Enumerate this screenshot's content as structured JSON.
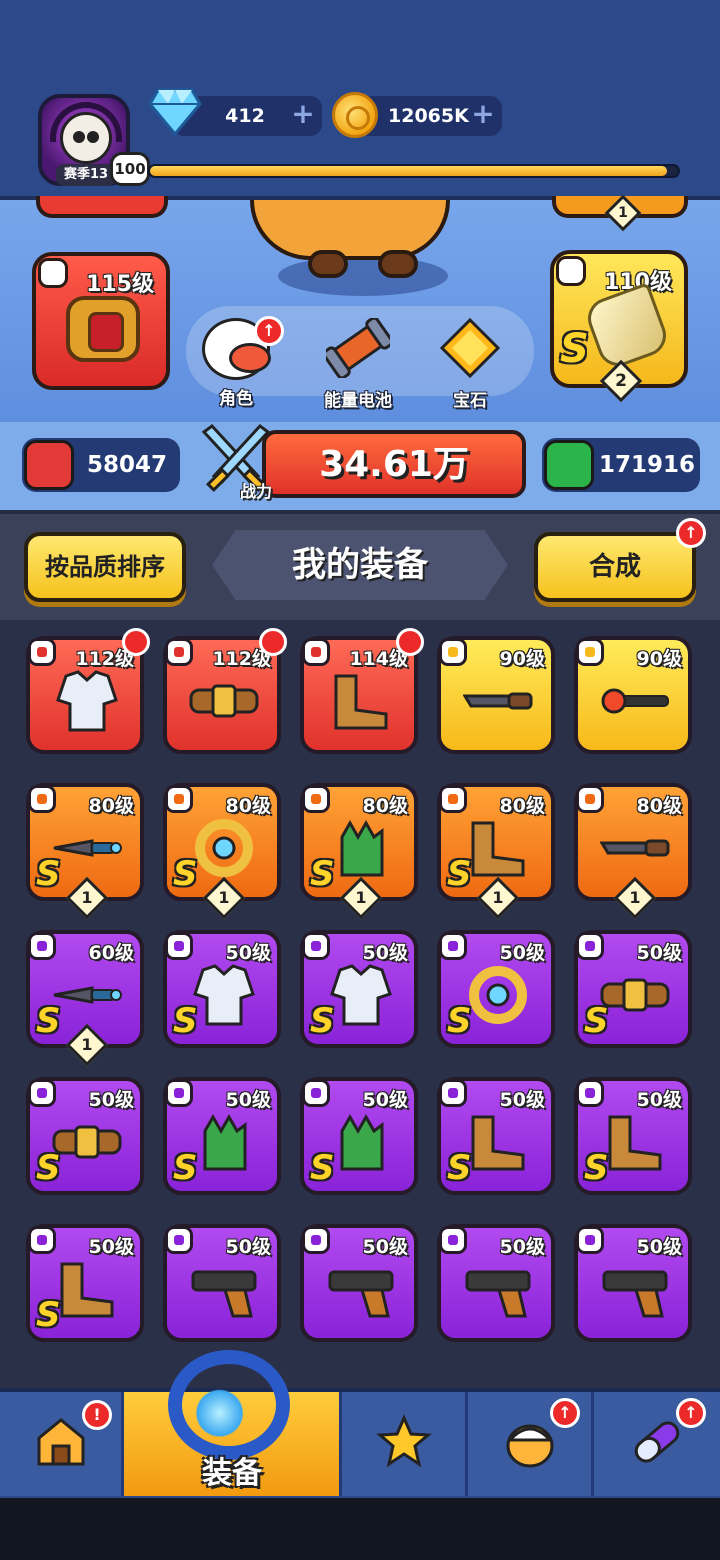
{
  "header": {
    "season_label": "赛季13",
    "player_level": "100",
    "xp_progress": 0.98,
    "gems": "412",
    "coins": "12065K",
    "plus_symbol": "+"
  },
  "hero": {
    "left_slot_level": "115级",
    "right_slot_level": "110级",
    "right_slot_grade": "S",
    "right_slot_stars": "2",
    "top_right_stars": "1",
    "buttons": [
      {
        "label": "角色",
        "has_alert": true
      },
      {
        "label": "能量电池",
        "has_alert": false
      },
      {
        "label": "宝石",
        "has_alert": false
      }
    ]
  },
  "stats": {
    "attack": "58047",
    "power": "34.61万",
    "power_label": "战力",
    "hp": "171916"
  },
  "panel": {
    "sort_button": "按品质排序",
    "title": "我的装备",
    "merge_button": "合成"
  },
  "equipment": [
    {
      "rarity": "red",
      "level": "112级",
      "item": "armor",
      "grade": "",
      "stars": "",
      "new": true
    },
    {
      "rarity": "red",
      "level": "112级",
      "item": "belt",
      "grade": "",
      "stars": "",
      "new": true
    },
    {
      "rarity": "red",
      "level": "114级",
      "item": "boots",
      "grade": "",
      "stars": "",
      "new": true
    },
    {
      "rarity": "yellow",
      "level": "90级",
      "item": "blade",
      "grade": "",
      "stars": "",
      "new": false
    },
    {
      "rarity": "yellow",
      "level": "90级",
      "item": "staff",
      "grade": "",
      "stars": "",
      "new": false
    },
    {
      "rarity": "orange",
      "level": "80级",
      "item": "sword",
      "grade": "S",
      "stars": "1",
      "new": false
    },
    {
      "rarity": "orange",
      "level": "80级",
      "item": "ring",
      "grade": "S",
      "stars": "1",
      "new": false
    },
    {
      "rarity": "orange",
      "level": "80级",
      "item": "gloves",
      "grade": "S",
      "stars": "1",
      "new": false
    },
    {
      "rarity": "orange",
      "level": "80级",
      "item": "boots",
      "grade": "S",
      "stars": "1",
      "new": false
    },
    {
      "rarity": "orange",
      "level": "80级",
      "item": "blade",
      "grade": "",
      "stars": "1",
      "new": false
    },
    {
      "rarity": "purple",
      "level": "60级",
      "item": "sword",
      "grade": "S",
      "stars": "1",
      "new": false
    },
    {
      "rarity": "purple",
      "level": "50级",
      "item": "armor",
      "grade": "S",
      "stars": "",
      "new": false
    },
    {
      "rarity": "purple",
      "level": "50级",
      "item": "armor",
      "grade": "S",
      "stars": "",
      "new": false
    },
    {
      "rarity": "purple",
      "level": "50级",
      "item": "ring",
      "grade": "S",
      "stars": "",
      "new": false
    },
    {
      "rarity": "purple",
      "level": "50级",
      "item": "belt",
      "grade": "S",
      "stars": "",
      "new": false
    },
    {
      "rarity": "purple",
      "level": "50级",
      "item": "belt",
      "grade": "S",
      "stars": "",
      "new": false
    },
    {
      "rarity": "purple",
      "level": "50级",
      "item": "gloves",
      "grade": "S",
      "stars": "",
      "new": false
    },
    {
      "rarity": "purple",
      "level": "50级",
      "item": "gloves",
      "grade": "S",
      "stars": "",
      "new": false
    },
    {
      "rarity": "purple",
      "level": "50级",
      "item": "boots",
      "grade": "S",
      "stars": "",
      "new": false
    },
    {
      "rarity": "purple",
      "level": "50级",
      "item": "boots",
      "grade": "S",
      "stars": "",
      "new": false
    },
    {
      "rarity": "purple",
      "level": "50级",
      "item": "boots",
      "grade": "S",
      "stars": "",
      "new": false
    },
    {
      "rarity": "purple",
      "level": "50级",
      "item": "gun",
      "grade": "",
      "stars": "",
      "new": false
    },
    {
      "rarity": "purple",
      "level": "50级",
      "item": "gun",
      "grade": "",
      "stars": "",
      "new": false
    },
    {
      "rarity": "purple",
      "level": "50级",
      "item": "gun",
      "grade": "",
      "stars": "",
      "new": false
    },
    {
      "rarity": "purple",
      "level": "50级",
      "item": "gun",
      "grade": "",
      "stars": "",
      "new": false
    }
  ],
  "nav": {
    "tabs": [
      "shop",
      "equipment",
      "weapons",
      "character",
      "pill"
    ],
    "active_label": "装备"
  }
}
